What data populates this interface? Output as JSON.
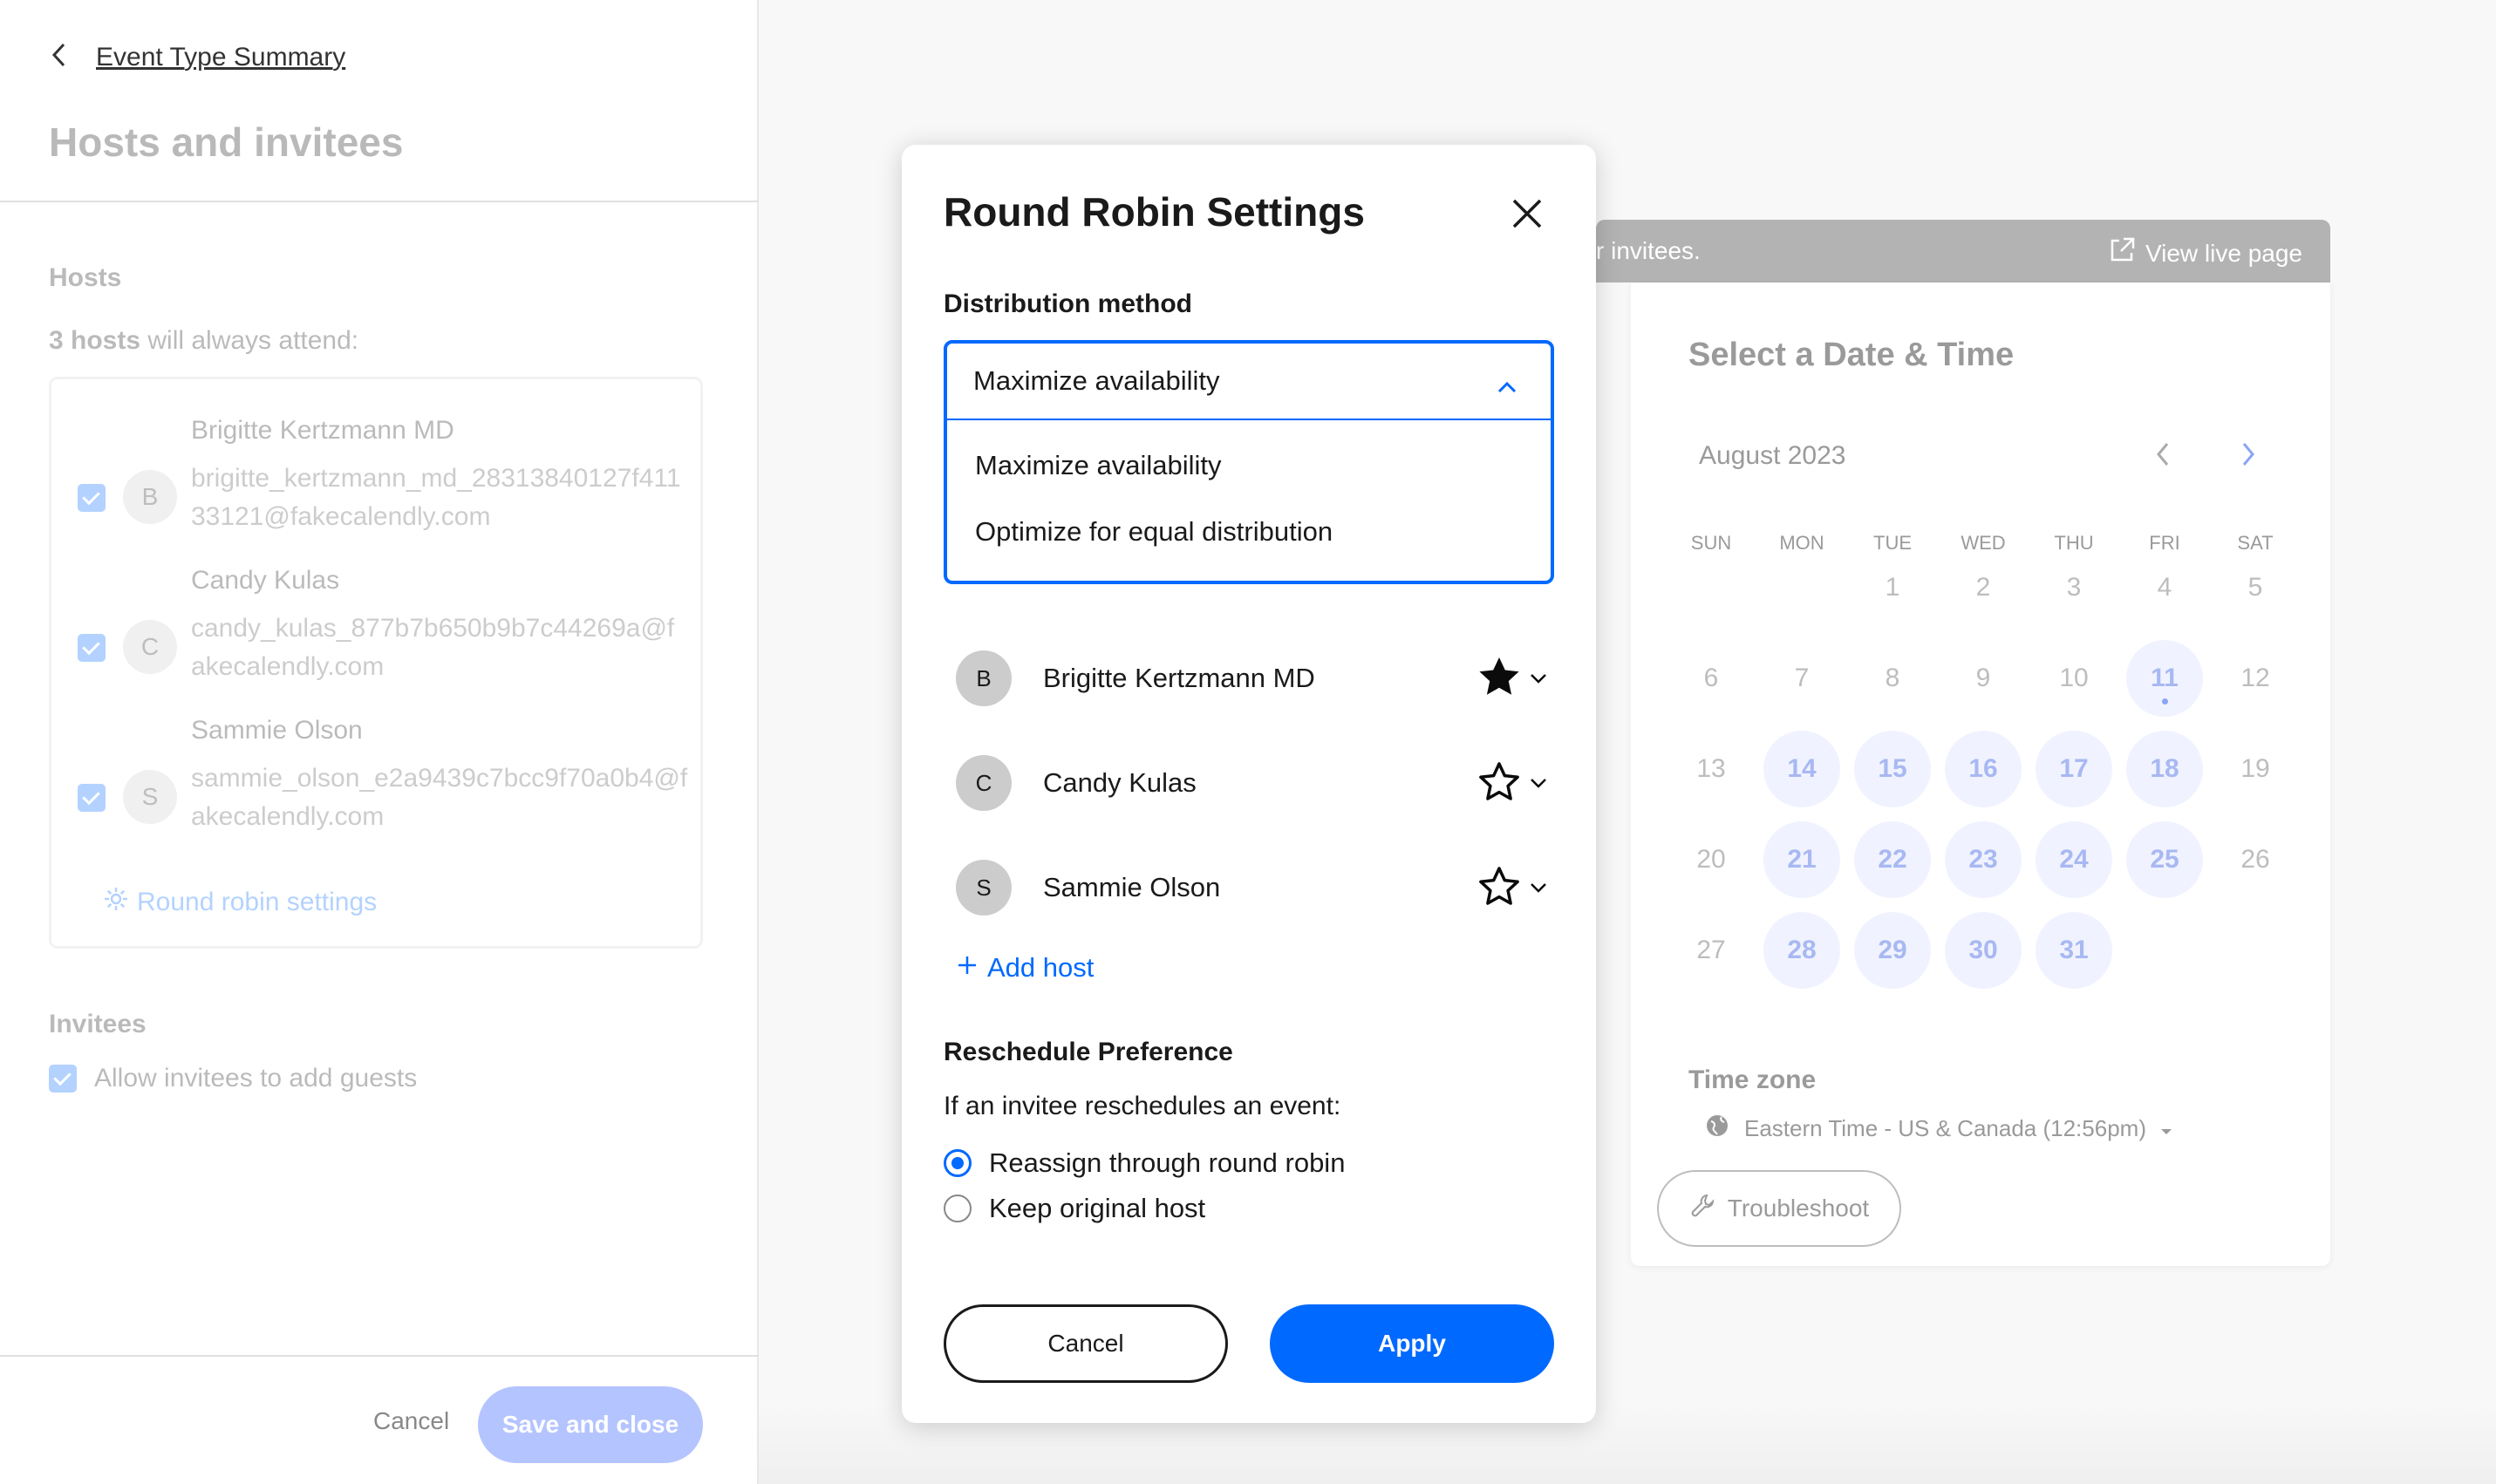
{
  "left_panel": {
    "back_link": "Event Type Summary",
    "title": "Hosts and invitees",
    "hosts_heading": "Hosts",
    "hosts_count": "3 hosts",
    "hosts_sub": " will always attend:",
    "hosts": [
      {
        "initial": "B",
        "name": "Brigitte Kertzmann MD",
        "email": "brigitte_kertzmann_md_28313840127f41133121@fakecalendly.com",
        "checked": true
      },
      {
        "initial": "C",
        "name": "Candy Kulas",
        "email": "candy_kulas_877b7b650b9b7c44269a@fakecalendly.com",
        "checked": true
      },
      {
        "initial": "S",
        "name": "Sammie Olson",
        "email": "sammie_olson_e2a9439c7bcc9f70a0b4@fakecalendly.com",
        "checked": true
      }
    ],
    "round_robin_link": "Round robin settings",
    "invitees_heading": "Invitees",
    "allow_guests_label": "Allow invitees to add guests",
    "cancel": "Cancel",
    "save": "Save and close"
  },
  "preview": {
    "banner_text": "r invitees.",
    "view_live": "View live page",
    "title": "Select a Date & Time",
    "month": "August 2023",
    "weekdays": [
      "SUN",
      "MON",
      "TUE",
      "WED",
      "THU",
      "FRI",
      "SAT"
    ],
    "weeks": [
      [
        "",
        "",
        "1",
        "2",
        "3",
        "4",
        "5"
      ],
      [
        "6",
        "7",
        "8",
        "9",
        "10",
        "11",
        "12"
      ],
      [
        "13",
        "14",
        "15",
        "16",
        "17",
        "18",
        "19"
      ],
      [
        "20",
        "21",
        "22",
        "23",
        "24",
        "25",
        "26"
      ],
      [
        "27",
        "28",
        "29",
        "30",
        "31",
        "",
        ""
      ]
    ],
    "available_days": [
      "11",
      "14",
      "15",
      "16",
      "17",
      "18",
      "21",
      "22",
      "23",
      "24",
      "25",
      "28",
      "29",
      "30",
      "31"
    ],
    "today": "11",
    "timezone_heading": "Time zone",
    "timezone": "Eastern Time - US & Canada (12:56pm)",
    "troubleshoot": "Troubleshoot"
  },
  "modal": {
    "title": "Round Robin Settings",
    "distribution_label": "Distribution method",
    "selected": "Maximize availability",
    "options": [
      "Maximize availability",
      "Optimize for equal distribution"
    ],
    "hosts": [
      {
        "initial": "B",
        "name": "Brigitte Kertzmann MD",
        "starred": true
      },
      {
        "initial": "C",
        "name": "Candy Kulas",
        "starred": false
      },
      {
        "initial": "S",
        "name": "Sammie Olson",
        "starred": false
      }
    ],
    "add_host": "Add host",
    "reschedule_heading": "Reschedule Preference",
    "reschedule_sub": "If an invitee reschedules an event:",
    "radio_options": [
      {
        "label": "Reassign through round robin",
        "selected": true
      },
      {
        "label": "Keep original host",
        "selected": false
      }
    ],
    "cancel": "Cancel",
    "apply": "Apply"
  },
  "colors": {
    "accent": "#0069ff",
    "disabled_accent": "#b4c4ff"
  }
}
